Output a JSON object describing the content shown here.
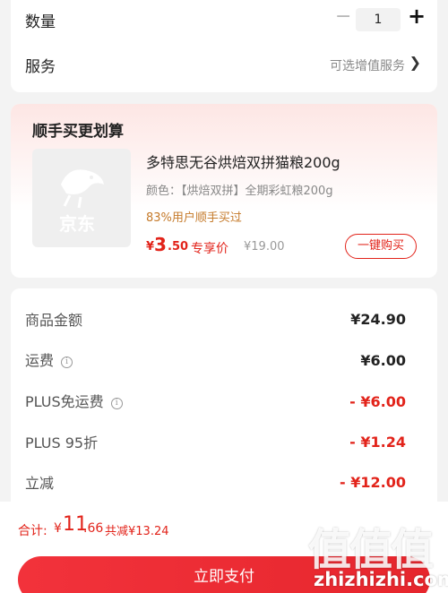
{
  "order": {
    "quantity_label": "数量",
    "quantity_minus": "−",
    "quantity_value": "1",
    "quantity_plus": "+",
    "service_label": "服务",
    "service_value": "可选增值服务",
    "service_chevron": "❯"
  },
  "promo": {
    "title": "顺手买更划算",
    "image_watermark": "京东",
    "product_name": "多特思无谷烘焙双拼猫粮200g",
    "variant": "颜色：【烘焙双拼】全期彩虹粮200g",
    "social_proof": "83%用户顺手买过",
    "price_currency": "¥",
    "price_int": "3",
    "price_dec": ".50",
    "price_tag": "专享价",
    "original_price": "¥19.00",
    "buy_button": "一键购买"
  },
  "amounts": {
    "items": [
      {
        "label": "商品金额",
        "value": "¥24.90",
        "red": false,
        "info": false
      },
      {
        "label": "运费",
        "value": "¥6.00",
        "red": false,
        "info": true
      },
      {
        "label": "PLUS免运费",
        "value": "- ¥6.00",
        "red": true,
        "info": true
      },
      {
        "label": "PLUS 95折",
        "value": "- ¥1.24",
        "red": true,
        "info": false
      },
      {
        "label": "立减",
        "value": "- ¥12.00",
        "red": true,
        "info": false
      }
    ]
  },
  "checkout": {
    "total_label": "合计:",
    "total_currency": "¥",
    "total_int": "11",
    "total_dec": ".66",
    "total_savings": "共减¥13.24",
    "pay_button": "立即支付"
  },
  "watermark": {
    "logo": "值值值",
    "site": "zhizhizhi.com"
  },
  "colors": {
    "accent": "#e2231a",
    "social": "#c57a2a",
    "background": "#f3f3f3"
  }
}
